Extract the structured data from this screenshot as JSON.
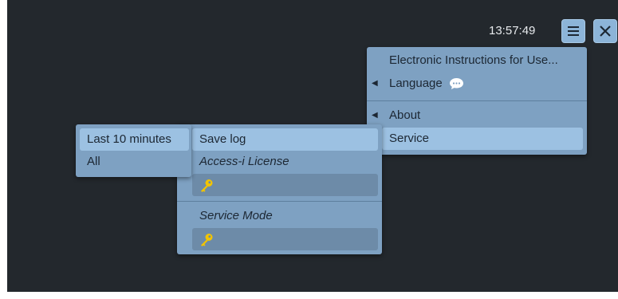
{
  "header": {
    "time": "13:57:49",
    "menu_icon": "hamburger-menu-icon",
    "close_icon": "close-icon"
  },
  "main_menu": {
    "items": [
      {
        "label": "Electronic Instructions for Use...",
        "has_submenu": false
      },
      {
        "label": "Language",
        "has_submenu": true,
        "icon": "speech-bubble-icon"
      },
      {
        "label": "About",
        "has_submenu": true
      },
      {
        "label": "Service",
        "has_submenu": false,
        "selected": true
      }
    ]
  },
  "service_menu": {
    "save_log_label": "Save log",
    "access_license_label": "Access-i License",
    "access_license_value": "",
    "service_mode_label": "Service Mode",
    "service_mode_value": "",
    "key_icon": "key-icon"
  },
  "log_menu": {
    "items": [
      {
        "label": "Last 10 minutes",
        "selected": true
      },
      {
        "label": "All",
        "selected": false
      }
    ]
  },
  "colors": {
    "background": "#23282d",
    "menu": "#7ea1c2",
    "highlight": "#9cc1e2",
    "key": "#f2c400"
  }
}
